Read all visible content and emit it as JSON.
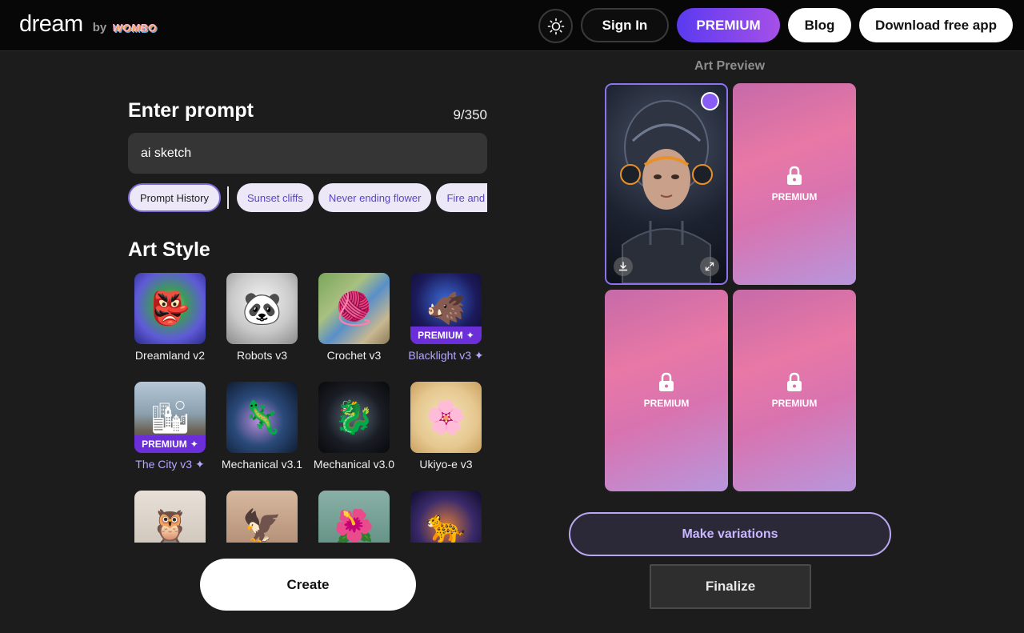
{
  "brand": {
    "name": "dream",
    "by": "by",
    "partner": "WOMBO"
  },
  "header": {
    "sign_in": "Sign In",
    "premium": "PREMIUM",
    "blog": "Blog",
    "download": "Download free app"
  },
  "prompt": {
    "title": "Enter prompt",
    "count": "9/350",
    "value": "ai sketch"
  },
  "chips": {
    "history": "Prompt History",
    "suggestions": [
      "Sunset cliffs",
      "Never ending flower",
      "Fire and w"
    ]
  },
  "art_style": {
    "title": "Art Style",
    "premium_tag": "PREMIUM",
    "items": [
      {
        "label": "Dreamland v2",
        "premium": false,
        "icon": "alien-face"
      },
      {
        "label": "Robots v3",
        "premium": false,
        "icon": "panda-robot"
      },
      {
        "label": "Crochet v3",
        "premium": false,
        "icon": "crochet-river"
      },
      {
        "label": "Blacklight v3",
        "premium": true,
        "icon": "boar-neon"
      },
      {
        "label": "The City v3",
        "premium": true,
        "icon": "pier-city"
      },
      {
        "label": "Mechanical v3.1",
        "premium": false,
        "icon": "mech-creature"
      },
      {
        "label": "Mechanical v3.0",
        "premium": false,
        "icon": "mech-dragon"
      },
      {
        "label": "Ukiyo-e v3",
        "premium": false,
        "icon": "bird-blossom"
      },
      {
        "label": "",
        "premium": false,
        "icon": "owl-tattoo"
      },
      {
        "label": "",
        "premium": false,
        "icon": "eagle-tattoo"
      },
      {
        "label": "",
        "premium": false,
        "icon": "flowers"
      },
      {
        "label": "",
        "premium": false,
        "icon": "cat-cosmic"
      }
    ]
  },
  "create": "Create",
  "preview": {
    "title": "Art Preview",
    "locked_label": "PREMIUM",
    "locked_count": 3
  },
  "actions": {
    "variations": "Make variations",
    "finalize": "Finalize"
  },
  "colors": {
    "accent": "#8c72ef",
    "premium_gradient_start": "#5a3af0",
    "premium_gradient_end": "#a650e8",
    "background": "#1c1c1c"
  }
}
